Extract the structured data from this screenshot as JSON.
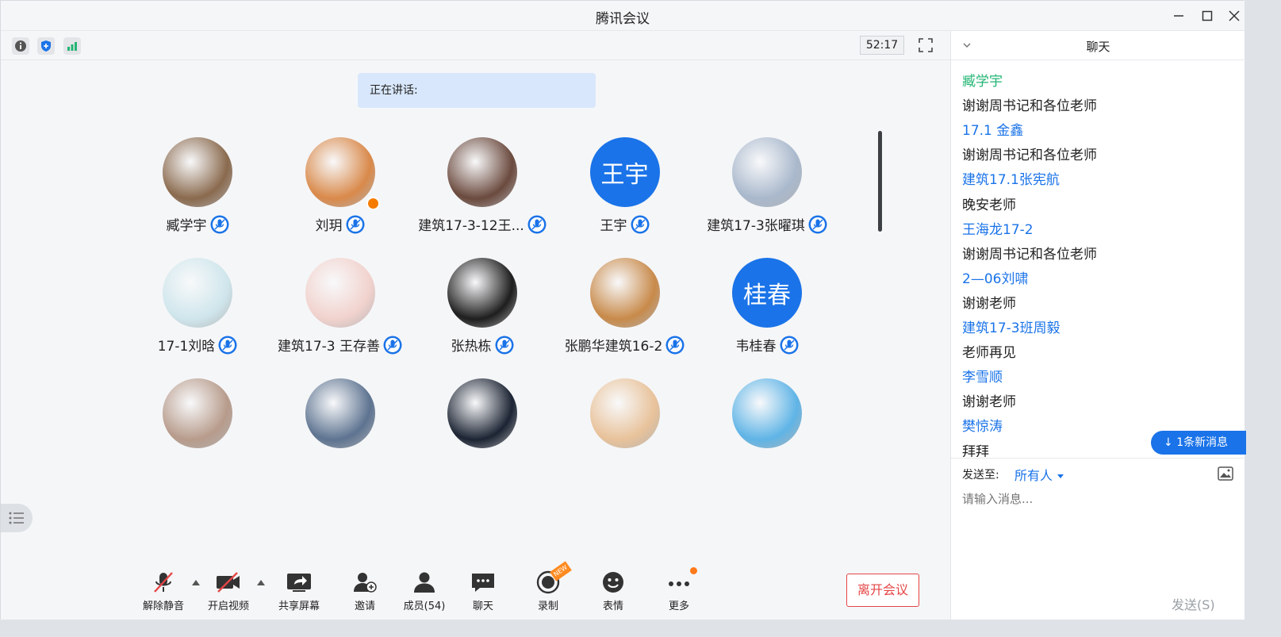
{
  "window": {
    "title": "腾讯会议"
  },
  "topbar": {
    "timer": "52:17"
  },
  "speaking": {
    "label": "正在讲话:"
  },
  "participants": [
    {
      "name": "臧学宇",
      "avatar": "photo",
      "color": "#8a6a4e"
    },
    {
      "name": "刘玥",
      "avatar": "photo",
      "color": "#d9894a",
      "host": true
    },
    {
      "name": "建筑17-3-12王...",
      "avatar": "photo",
      "color": "#6b4a3e"
    },
    {
      "name": "王宇",
      "avatar": "text",
      "avatar_text": "王宇"
    },
    {
      "name": "建筑17-3张曜琪",
      "avatar": "photo",
      "color": "#a9b8cc"
    },
    {
      "name": "17-1刘晗",
      "avatar": "photo",
      "color": "#cfe6ec"
    },
    {
      "name": "建筑17-3 王存善",
      "avatar": "photo",
      "color": "#f1d2cd"
    },
    {
      "name": "张热栋",
      "avatar": "photo",
      "color": "#1e1e1e"
    },
    {
      "name": "张鹏华建筑16-2",
      "avatar": "photo",
      "color": "#c88a4a"
    },
    {
      "name": "韦桂春",
      "avatar": "text",
      "avatar_text": "桂春"
    },
    {
      "name": "",
      "avatar": "photo",
      "color": "#b79b8b"
    },
    {
      "name": "",
      "avatar": "photo",
      "color": "#5d7390"
    },
    {
      "name": "",
      "avatar": "photo",
      "color": "#1c2433"
    },
    {
      "name": "",
      "avatar": "photo",
      "color": "#e8c29a"
    },
    {
      "name": "",
      "avatar": "photo",
      "color": "#5fb4e6"
    }
  ],
  "toolbar": {
    "unmute": "解除静音",
    "video": "开启视频",
    "share": "共享屏幕",
    "invite": "邀请",
    "members": "成员(54)",
    "chat": "聊天",
    "record": "录制",
    "record_badge": "NEW",
    "emoji": "表情",
    "more": "更多",
    "leave": "离开会议"
  },
  "chat": {
    "title": "聊天",
    "messages": [
      {
        "type": "sender",
        "text": "臧学宇",
        "green": true
      },
      {
        "type": "text",
        "text": "谢谢周书记和各位老师"
      },
      {
        "type": "sender",
        "text": "17.1 金鑫"
      },
      {
        "type": "text",
        "text": "谢谢周书记和各位老师"
      },
      {
        "type": "sender",
        "text": "建筑17.1张宪航"
      },
      {
        "type": "text",
        "text": "晚安老师"
      },
      {
        "type": "sender",
        "text": "王海龙17-2"
      },
      {
        "type": "text",
        "text": "谢谢周书记和各位老师"
      },
      {
        "type": "sender",
        "text": "2—06刘啸"
      },
      {
        "type": "text",
        "text": "谢谢老师"
      },
      {
        "type": "sender",
        "text": "建筑17-3班周毅"
      },
      {
        "type": "text",
        "text": "老师再见"
      },
      {
        "type": "sender",
        "text": "李雪顺"
      },
      {
        "type": "text",
        "text": "谢谢老师"
      },
      {
        "type": "sender",
        "text": "樊惊涛"
      },
      {
        "type": "text",
        "text": "拜拜"
      }
    ],
    "new_message_badge": "1条新消息",
    "send_to_label": "发送至:",
    "send_to_value": "所有人",
    "input_placeholder": "请输入消息...",
    "send_button": "发送(S)"
  },
  "colors": {
    "accent": "#1a73e8",
    "leave": "#e64545"
  }
}
